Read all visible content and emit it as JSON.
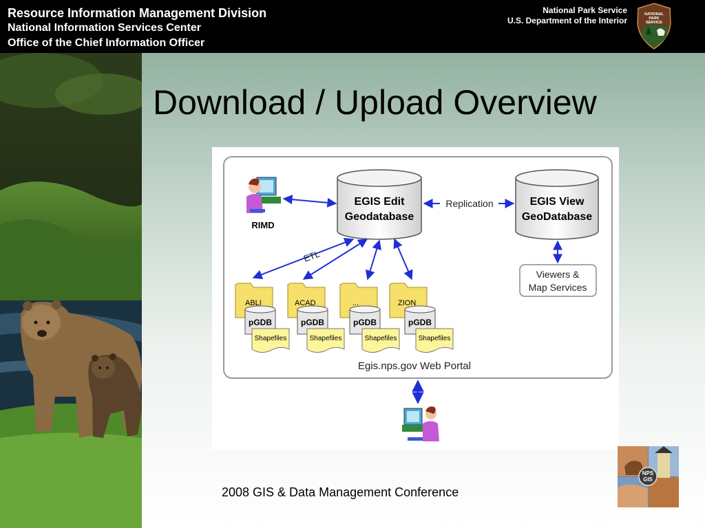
{
  "header": {
    "left_line1": "Resource Information Management Division",
    "left_line2": "National Information Services Center",
    "left_line3": "Office of the Chief Information Officer",
    "right_line1": "National Park Service",
    "right_line2": "U.S. Department of the Interior",
    "logo_text": [
      "NATIONAL",
      "PARK",
      "SERVICE"
    ]
  },
  "slide": {
    "title": "Download / Upload Overview",
    "footer": "2008 GIS & Data Management Conference"
  },
  "diagram": {
    "user_top_label": "RIMD",
    "db_edit_line1": "EGIS Edit",
    "db_edit_line2": "Geodatabase",
    "replication_label": "Replication",
    "db_view_line1": "EGIS View",
    "db_view_line2": "GeoDatabase",
    "viewers_line1": "Viewers &",
    "viewers_line2": "Map Services",
    "etl_label": "ETL",
    "folders": [
      {
        "label": "ABLI",
        "pgdb": "pGDB",
        "shape": "Shapefiles"
      },
      {
        "label": "ACAD",
        "pgdb": "pGDB",
        "shape": "Shapefiles"
      },
      {
        "label": "...",
        "pgdb": "pGDB",
        "shape": "Shapefiles"
      },
      {
        "label": "ZION",
        "pgdb": "pGDB",
        "shape": "Shapefiles"
      }
    ],
    "portal_label": "Egis.nps.gov  Web Portal"
  },
  "gis_logo_text": [
    "NPS",
    "GIS"
  ],
  "colors": {
    "arrow": "#1f2fd6",
    "folder": "#f6df6a",
    "shapefile": "#fdf59a",
    "header_bg": "#000000"
  }
}
